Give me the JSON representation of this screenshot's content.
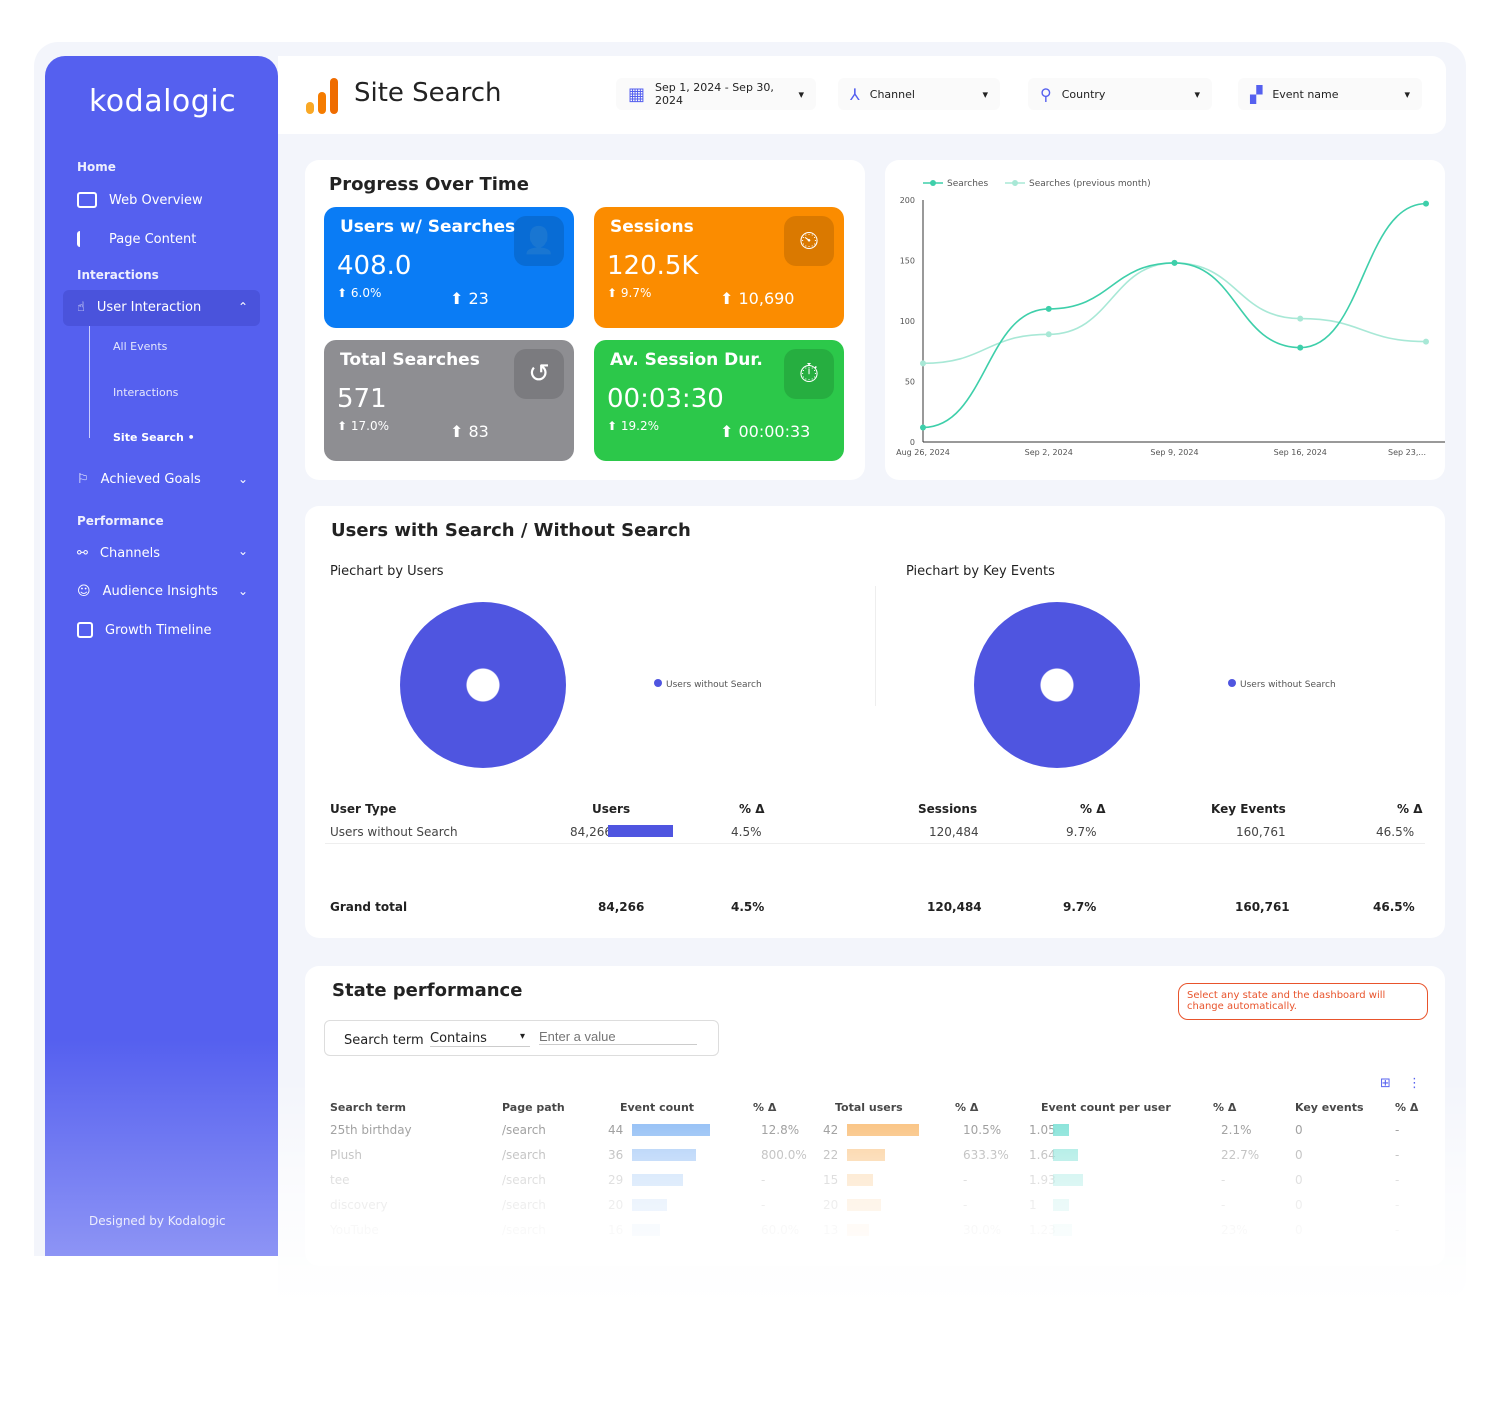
{
  "brand": "kodalogic",
  "sidebar": {
    "sections": [
      {
        "label": "Home"
      },
      {
        "label": "Interactions"
      },
      {
        "label": "Performance"
      }
    ],
    "items": [
      {
        "label": "Web Overview",
        "icon": "browser-icon"
      },
      {
        "label": "Page Content",
        "icon": "list-icon"
      },
      {
        "label": "User Interaction",
        "icon": "pointer-hand-icon"
      },
      {
        "label": "Achieved Goals",
        "icon": "flag-icon"
      },
      {
        "label": "Channels",
        "icon": "share-icon"
      },
      {
        "label": "Audience Insights",
        "icon": "audience-icon"
      },
      {
        "label": "Growth Timeline",
        "icon": "chart-icon"
      }
    ],
    "subitems": [
      {
        "label": "All Events"
      },
      {
        "label": "Interactions"
      },
      {
        "label": "Site Search •"
      }
    ],
    "footer": "Designed by Kodalogic"
  },
  "header": {
    "title": "Site Search",
    "filters": [
      {
        "label": "Sep 1, 2024 - Sep 30, 2024",
        "icon": "calendar-icon"
      },
      {
        "label": "Channel",
        "icon": "channel-icon"
      },
      {
        "label": "Country",
        "icon": "location-pin-icon"
      },
      {
        "label": "Event name",
        "icon": "widgets-icon"
      }
    ]
  },
  "progress": {
    "title": "Progress Over Time",
    "kpis": [
      {
        "title": "Users w/ Searches",
        "value": "408.0",
        "pct": "6.0%",
        "delta": "23",
        "color": "#0a7cf5",
        "icon": "user-icon"
      },
      {
        "title": "Sessions",
        "value": "120.5K",
        "pct": "9.7%",
        "delta": "10,690",
        "color": "#fb8c00",
        "icon": "user-clock-icon"
      },
      {
        "title": "Total Searches",
        "value": "571",
        "pct": "17.0%",
        "delta": "83",
        "color": "#8e8e92",
        "icon": "refresh-icon"
      },
      {
        "title": "Av. Session Dur.",
        "value": "00:03:30",
        "pct": "19.2%",
        "delta": "00:00:33",
        "color": "#2cc84a",
        "icon": "stopwatch-icon"
      }
    ]
  },
  "chart_data": {
    "type": "line",
    "x": [
      "Aug 26, 2024",
      "Sep 2, 2024",
      "Sep 9, 2024",
      "Sep 16, 2024",
      "Sep 23, 2024"
    ],
    "xtick_labels": [
      "Aug 26, 2024",
      "Sep 2, 2024",
      "Sep 9, 2024",
      "Sep 16, 2024",
      "Sep 23,..."
    ],
    "series": [
      {
        "name": "Searches",
        "values": [
          12,
          110,
          148,
          78,
          197
        ],
        "color": "#3ecfaa"
      },
      {
        "name": "Searches (previous month)",
        "values": [
          65,
          89,
          148,
          102,
          83
        ],
        "color": "#a8e8d6"
      }
    ],
    "ylim": [
      0,
      200
    ],
    "yticks": [
      0,
      50,
      100,
      150,
      200
    ],
    "legend": "top-left",
    "grid": false
  },
  "users": {
    "title": "Users with Search / Without Search",
    "pie1": {
      "title": "Piechart by Users",
      "legend": "Users without Search"
    },
    "pie2": {
      "title": "Piechart by Key Events",
      "legend": "Users without Search"
    },
    "headers": [
      "User Type",
      "Users",
      "% Δ",
      "Sessions",
      "% Δ",
      "Key Events",
      "% Δ"
    ],
    "row": [
      "Users without Search",
      "84,266",
      "4.5%",
      "120,484",
      "9.7%",
      "160,761",
      "46.5%"
    ],
    "total": [
      "Grand total",
      "84,266",
      "4.5%",
      "120,484",
      "9.7%",
      "160,761",
      "46.5%"
    ],
    "pie_color": "#4f55e0"
  },
  "state": {
    "title": "State performance",
    "note": "Select any state and the dashboard will change automatically.",
    "filter_label": "Search term",
    "filter_op": "Contains",
    "filter_placeholder": "Enter a value",
    "headers": [
      "Search term",
      "Page path",
      "Event count",
      "% Δ",
      "Total users",
      "% Δ",
      "Event count per user",
      "% Δ",
      "Key events",
      "% Δ"
    ],
    "rows": [
      [
        "25th birthday",
        "/search",
        "44",
        "12.8%",
        "42",
        "10.5%",
        "1.05",
        "2.1%",
        "0",
        "-"
      ],
      [
        "Plush",
        "/search",
        "36",
        "800.0%",
        "22",
        "633.3%",
        "1.64",
        "22.7%",
        "0",
        "-"
      ],
      [
        "tee",
        "/search",
        "29",
        "-",
        "15",
        "-",
        "1.93",
        "-",
        "0",
        "-"
      ],
      [
        "discovery",
        "/search",
        "20",
        "-",
        "20",
        "-",
        "1",
        "-",
        "0",
        "-"
      ],
      [
        "YouTube",
        "/search",
        "16",
        "60.0%",
        "13",
        "30.0%",
        "1.23",
        "23%",
        "0",
        "-"
      ]
    ]
  }
}
